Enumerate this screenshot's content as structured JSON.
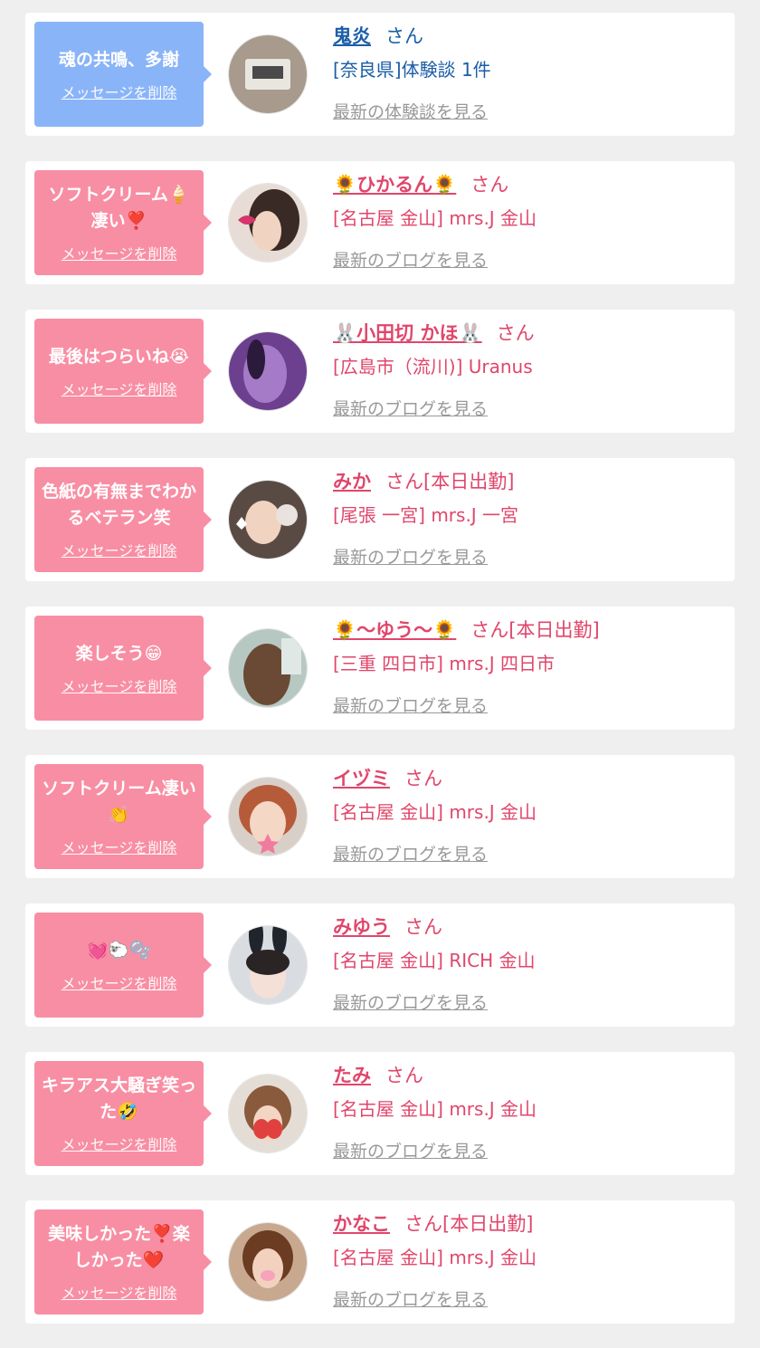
{
  "colors": {
    "card_bg": "#ffffff",
    "page_bg": "#efefef",
    "bubble_blue": "#8ab4f8",
    "bubble_pink": "#f88ea3",
    "text_blue": "#1a5da8",
    "text_pink": "#e0466b",
    "link_gray": "#999999"
  },
  "entries": [
    {
      "message": "魂の共鳴、多謝",
      "delete_label": "メッセージを削除",
      "name": "鬼炎",
      "san": "さん",
      "status": "",
      "shop": "[奈良県]体験談 1件",
      "latest_link": "最新の体験談を見る",
      "theme": "blue",
      "avatar": "clock-photo-icon"
    },
    {
      "message": "ソフトクリーム🍦凄い❣️",
      "delete_label": "メッセージを削除",
      "name": "🌻ひかるん🌻",
      "san": "さん",
      "status": "",
      "shop": "[名古屋 金山] mrs.J 金山",
      "latest_link": "最新のブログを見る",
      "theme": "pink",
      "avatar": "girl-lips-sticker-photo-icon"
    },
    {
      "message": "最後はつらいね😭",
      "delete_label": "メッセージを削除",
      "name": "🐰小田切 かほ🐰",
      "san": "さん",
      "status": "",
      "shop": "[広島市（流川)] Uranus",
      "latest_link": "最新のブログを見る",
      "theme": "pink",
      "avatar": "purple-photo-icon"
    },
    {
      "message": "色紙の有無までわかるベテラン笑",
      "delete_label": "メッセージを削除",
      "name": "みか",
      "san": "さん",
      "status": "[本日出勤]",
      "shop": "[尾張 一宮] mrs.J 一宮",
      "latest_link": "最新のブログを見る",
      "theme": "pink",
      "avatar": "girl-cat-sticker-photo-icon"
    },
    {
      "message": "楽しそう😁",
      "delete_label": "メッセージを削除",
      "name": "🌻〜ゆう〜🌻",
      "san": "さん",
      "status": "[本日出勤]",
      "shop": "[三重 四日市] mrs.J 四日市",
      "latest_link": "最新のブログを見る",
      "theme": "pink",
      "avatar": "braided-hair-photo-icon"
    },
    {
      "message": "ソフトクリーム凄い👏",
      "delete_label": "メッセージを削除",
      "name": "イヅミ",
      "san": "さん",
      "status": "",
      "shop": "[名古屋 金山] mrs.J 金山",
      "latest_link": "最新のブログを見る",
      "theme": "pink",
      "avatar": "girl-star-sticker-photo-icon"
    },
    {
      "message": "💓🐑🫧",
      "delete_label": "メッセージを削除",
      "name": "みゆう",
      "san": "さん",
      "status": "",
      "shop": "[名古屋 金山] RICH 金山",
      "latest_link": "最新のブログを見る",
      "theme": "pink",
      "avatar": "girl-bunny-ears-photo-icon"
    },
    {
      "message": "キラアス大騒ぎ笑った🤣",
      "delete_label": "メッセージを削除",
      "name": "たみ",
      "san": "さん",
      "status": "",
      "shop": "[名古屋 金山] mrs.J 金山",
      "latest_link": "最新のブログを見る",
      "theme": "pink",
      "avatar": "girl-strawberry-sticker-photo-icon"
    },
    {
      "message": "美味しかった❣️楽しかった❤️",
      "delete_label": "メッセージを削除",
      "name": "かなこ",
      "san": "さん",
      "status": "[本日出勤]",
      "shop": "[名古屋 金山] mrs.J 金山",
      "latest_link": "最新のブログを見る",
      "theme": "pink",
      "avatar": "girl-pig-sticker-photo-icon"
    }
  ]
}
